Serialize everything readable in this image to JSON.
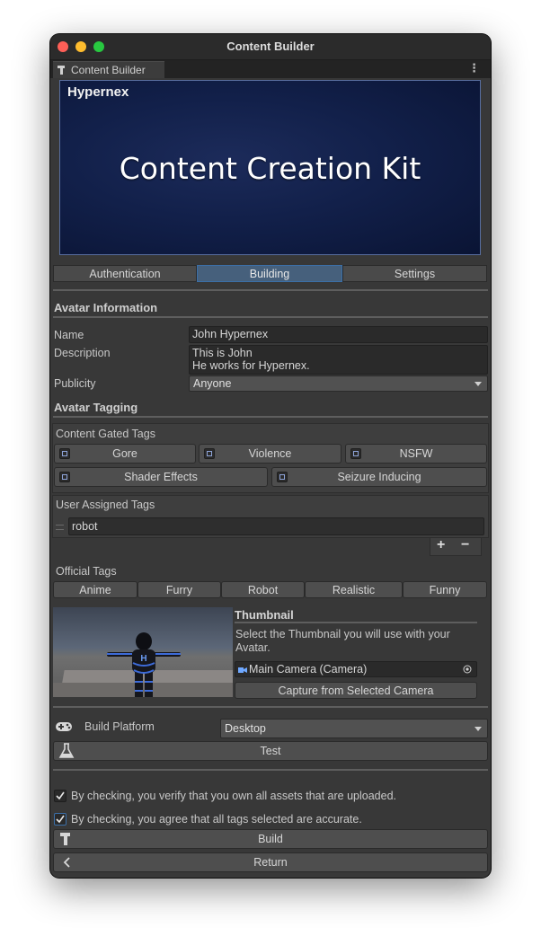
{
  "window": {
    "title": "Content Builder",
    "tab_label": "Content Builder",
    "menu_glyph": "⋮"
  },
  "banner": {
    "brand": "Hypernex",
    "headline": "Content Creation Kit"
  },
  "tabs": [
    {
      "label": "Authentication",
      "active": false
    },
    {
      "label": "Building",
      "active": true
    },
    {
      "label": "Settings",
      "active": false
    }
  ],
  "avatar_info": {
    "section_title": "Avatar Information",
    "name_label": "Name",
    "name_value": "John Hypernex",
    "description_label": "Description",
    "description_line1": "This is John",
    "description_line2": "He works for Hypernex.",
    "publicity_label": "Publicity",
    "publicity_value": "Anyone"
  },
  "tagging": {
    "section_title": "Avatar Tagging",
    "gated_title": "Content Gated Tags",
    "gated_tags": [
      "Gore",
      "Violence",
      "NSFW",
      "Shader Effects",
      "Seizure Inducing"
    ],
    "user_title": "User Assigned Tags",
    "user_tag_value": "robot",
    "add_glyph": "+",
    "remove_glyph": "−",
    "official_title": "Official Tags",
    "official_tags": [
      "Anime",
      "Furry",
      "Robot",
      "Realistic",
      "Funny"
    ]
  },
  "thumbnail": {
    "title": "Thumbnail",
    "description_line1": "Select the Thumbnail you will use with your",
    "description_line2": "Avatar.",
    "camera_value": "Main Camera (Camera)",
    "capture_label": "Capture from Selected Camera"
  },
  "build": {
    "platform_label": "Build Platform",
    "platform_value": "Desktop",
    "test_label": "Test",
    "agree_assets": "By checking, you verify that you own all assets that are uploaded.",
    "agree_tags": "By checking, you agree that all tags selected are accurate.",
    "build_label": "Build",
    "return_label": "Return"
  },
  "colors": {
    "active_tab": "#46607c",
    "banner_bg": "#12204a",
    "accent_blue": "#3b6fa8"
  },
  "icons": [
    "hammer-icon",
    "gamepad-icon",
    "flask-icon",
    "chevron-left-icon",
    "camera-icon",
    "object-picker-icon",
    "checkmark-icon"
  ]
}
